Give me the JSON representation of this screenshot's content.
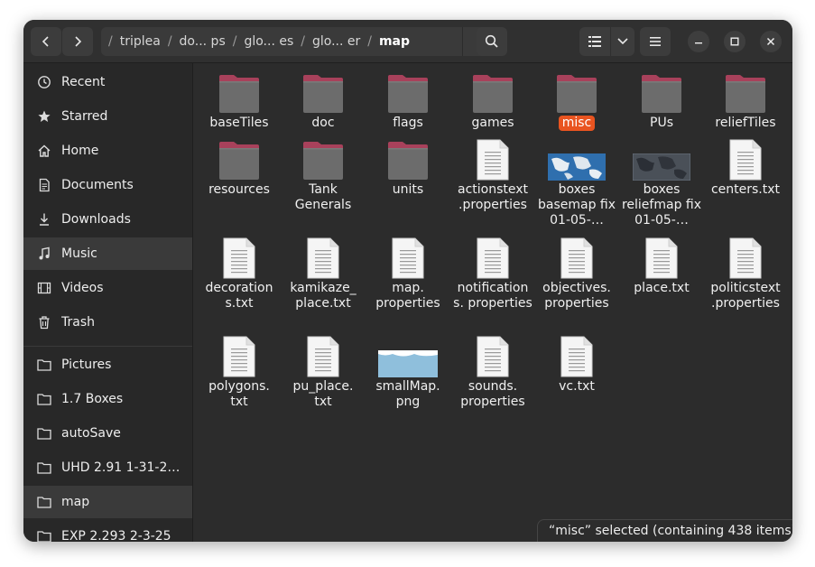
{
  "colors": {
    "accent": "#e95420",
    "folder_tab": "#a8415b",
    "folder_body": "#6c6c6c",
    "window_bg": "#2c2c2c",
    "sidebar_bg": "#282828"
  },
  "header": {
    "back_icon": "chevron-left-icon",
    "forward_icon": "chevron-right-icon",
    "breadcrumbs": [
      "triplea",
      "do... ps",
      "glo... es",
      "glo... er",
      "map"
    ],
    "path_menu_icon": "kebab-icon",
    "search_icon": "search-icon",
    "view_icon": "list-view-icon",
    "view_dropdown_icon": "chevron-down-icon",
    "main_menu_icon": "hamburger-icon",
    "minimize_icon": "minimize-icon",
    "maximize_icon": "maximize-icon",
    "close_icon": "close-icon"
  },
  "sidebar": {
    "items": [
      {
        "label": "Recent",
        "icon": "clock-icon"
      },
      {
        "label": "Starred",
        "icon": "star-icon"
      },
      {
        "label": "Home",
        "icon": "home-icon"
      },
      {
        "label": "Documents",
        "icon": "document-icon"
      },
      {
        "label": "Downloads",
        "icon": "download-icon"
      },
      {
        "label": "Music",
        "icon": "music-icon"
      },
      {
        "label": "Videos",
        "icon": "film-icon"
      },
      {
        "label": "Trash",
        "icon": "trash-icon"
      }
    ],
    "bookmarks": [
      {
        "label": "Pictures",
        "icon": "folder-icon"
      },
      {
        "label": "1.7 Boxes",
        "icon": "folder-icon"
      },
      {
        "label": "autoSave",
        "icon": "folder-icon"
      },
      {
        "label": "UHD 2.91 1-31-24 …",
        "icon": "folder-icon"
      },
      {
        "label": "map",
        "icon": "folder-icon"
      },
      {
        "label": "EXP 2.293 2-3-25",
        "icon": "folder-icon"
      }
    ]
  },
  "files": [
    {
      "name": "baseTiles",
      "type": "folder"
    },
    {
      "name": "doc",
      "type": "folder"
    },
    {
      "name": "flags",
      "type": "folder"
    },
    {
      "name": "games",
      "type": "folder"
    },
    {
      "name": "misc",
      "type": "folder",
      "selected": true
    },
    {
      "name": "PUs",
      "type": "folder"
    },
    {
      "name": "reliefTiles",
      "type": "folder"
    },
    {
      "name": "resources",
      "type": "folder"
    },
    {
      "name": "Tank Generals",
      "type": "folder"
    },
    {
      "name": "units",
      "type": "folder"
    },
    {
      "name": "actionstext .properties",
      "type": "text"
    },
    {
      "name": "boxes basemap fix 01-05-…",
      "type": "image-map"
    },
    {
      "name": "boxes reliefmap fix 01-05-…",
      "type": "image-relief"
    },
    {
      "name": "centers.txt",
      "type": "text"
    },
    {
      "name": "decoration s.txt",
      "type": "text"
    },
    {
      "name": "kamikaze_ place.txt",
      "type": "text"
    },
    {
      "name": "map. properties",
      "type": "text"
    },
    {
      "name": "notification s. properties",
      "type": "text"
    },
    {
      "name": "objectives. properties",
      "type": "text"
    },
    {
      "name": "place.txt",
      "type": "text"
    },
    {
      "name": "politicstext .properties",
      "type": "text"
    },
    {
      "name": "polygons. txt",
      "type": "text"
    },
    {
      "name": "pu_place. txt",
      "type": "text"
    },
    {
      "name": "smallMap. png",
      "type": "image-small"
    },
    {
      "name": "sounds. properties",
      "type": "text"
    },
    {
      "name": "vc.txt",
      "type": "text"
    }
  ],
  "status": {
    "text": "“misc” selected  (containing 438 items)"
  }
}
